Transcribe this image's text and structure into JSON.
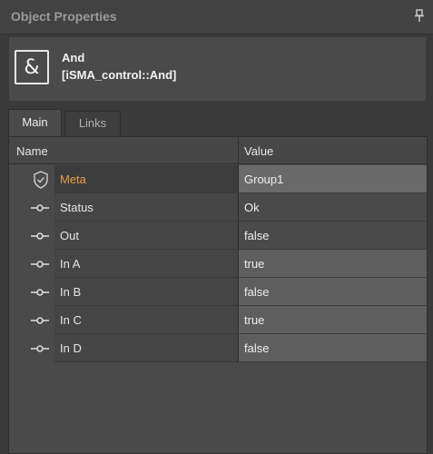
{
  "panel": {
    "title": "Object Properties"
  },
  "object": {
    "icon_symbol": "&",
    "name": "And",
    "type": "[iSMA_control::And]"
  },
  "tabs": [
    {
      "label": "Main",
      "active": true
    },
    {
      "label": "Links",
      "active": false
    }
  ],
  "table": {
    "columns": [
      "Name",
      "Value"
    ],
    "rows": [
      {
        "name": "Meta",
        "value": "Group1",
        "icon": "shield-icon",
        "selected": true,
        "editable": true
      },
      {
        "name": "Status",
        "value": "Ok",
        "icon": "slot-icon",
        "selected": false,
        "editable": false
      },
      {
        "name": "Out",
        "value": "false",
        "icon": "slot-icon",
        "selected": false,
        "editable": false
      },
      {
        "name": "In A",
        "value": "true",
        "icon": "slot-icon",
        "selected": false,
        "editable": true
      },
      {
        "name": "In B",
        "value": "false",
        "icon": "slot-icon",
        "selected": false,
        "editable": true
      },
      {
        "name": "In C",
        "value": "true",
        "icon": "slot-icon",
        "selected": false,
        "editable": true
      },
      {
        "name": "In D",
        "value": "false",
        "icon": "slot-icon",
        "selected": false,
        "editable": true
      }
    ]
  },
  "colors": {
    "background": "#3a3a3a",
    "selected_label": "#e3a040",
    "editable_cell": "#5e5e5e"
  }
}
